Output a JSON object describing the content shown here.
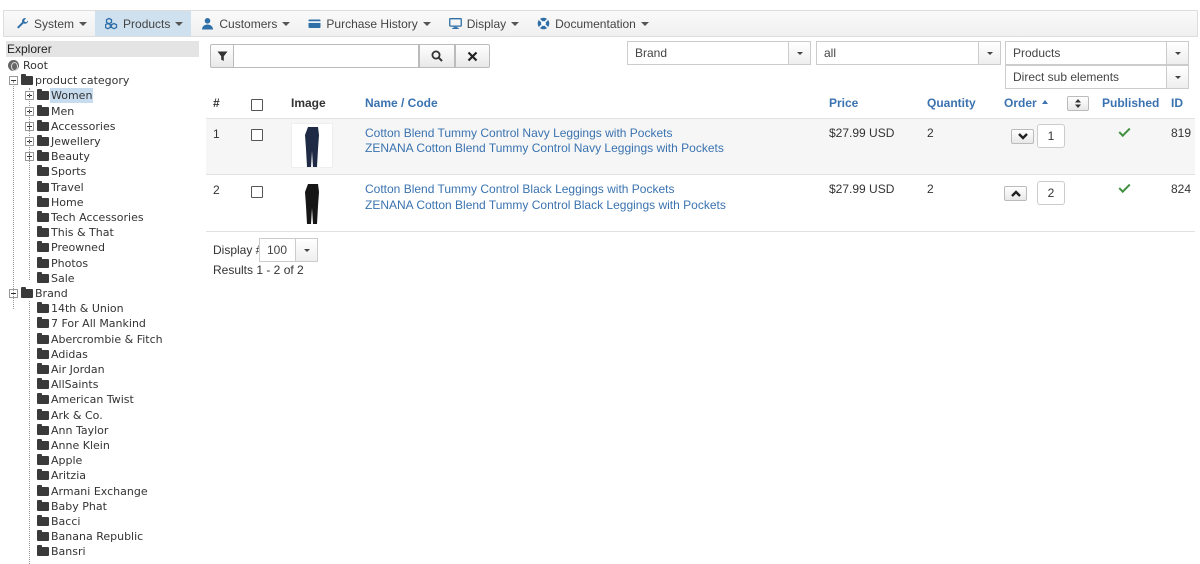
{
  "menu": [
    {
      "id": "system",
      "label": "System",
      "icon": "wrench-icon"
    },
    {
      "id": "products",
      "label": "Products",
      "icon": "cubes-icon",
      "active": true
    },
    {
      "id": "customers",
      "label": "Customers",
      "icon": "user-icon"
    },
    {
      "id": "purchase-history",
      "label": "Purchase History",
      "icon": "credit-card-icon"
    },
    {
      "id": "display",
      "label": "Display",
      "icon": "monitor-icon"
    },
    {
      "id": "documentation",
      "label": "Documentation",
      "icon": "life-ring-icon"
    }
  ],
  "explorer": {
    "title": "Explorer",
    "root": "Root",
    "category": "product category",
    "categories": [
      "Women",
      "Men",
      "Accessories",
      "Jewellery",
      "Beauty",
      "Sports",
      "Travel",
      "Home",
      "Tech Accessories",
      "This & That",
      "Preowned",
      "Photos",
      "Sale"
    ],
    "expandable_categories": [
      "Women",
      "Men",
      "Accessories",
      "Jewellery",
      "Beauty"
    ],
    "selected": "Women",
    "brand": "Brand",
    "brands": [
      "14th & Union",
      "7 For All Mankind",
      "Abercrombie & Fitch",
      "Adidas",
      "Air Jordan",
      "AllSaints",
      "American Twist",
      "Ark & Co.",
      "Ann Taylor",
      "Anne Klein",
      "Apple",
      "Aritzia",
      "Armani Exchange",
      "Baby Phat",
      "Bacci",
      "Banana Republic",
      "Bansri"
    ]
  },
  "filters": {
    "search_value": "",
    "search_placeholder": "",
    "brand_select": "Brand",
    "value_select": "all",
    "type_select": "Products",
    "scope_select": "Direct sub elements"
  },
  "table": {
    "headers": {
      "num": "#",
      "image": "Image",
      "name": "Name / Code",
      "price": "Price",
      "quantity": "Quantity",
      "order": "Order",
      "published": "Published",
      "id": "ID"
    },
    "rows": [
      {
        "num": "1",
        "name": "Cotton Blend Tummy Control Navy Leggings with Pockets",
        "code": "ZENANA Cotton Blend Tummy Control Navy Leggings with Pockets",
        "price": "$27.99 USD",
        "quantity": "2",
        "order": "1",
        "order_dir": "down",
        "published": true,
        "id": "819",
        "legging_color": "#1f2a44"
      },
      {
        "num": "2",
        "name": "Cotton Blend Tummy Control Black Leggings with Pockets",
        "code": "ZENANA Cotton Blend Tummy Control Black Leggings with Pockets",
        "price": "$27.99 USD",
        "quantity": "2",
        "order": "2",
        "order_dir": "up",
        "published": true,
        "id": "824",
        "legging_color": "#161616"
      }
    ]
  },
  "footer": {
    "display_label": "Display #",
    "display_value": "100",
    "results": "Results 1 - 2 of 2"
  },
  "colors": {
    "link": "#3a73b0",
    "published": "#3e8f3e",
    "menu_active": "#cfe0ee"
  }
}
